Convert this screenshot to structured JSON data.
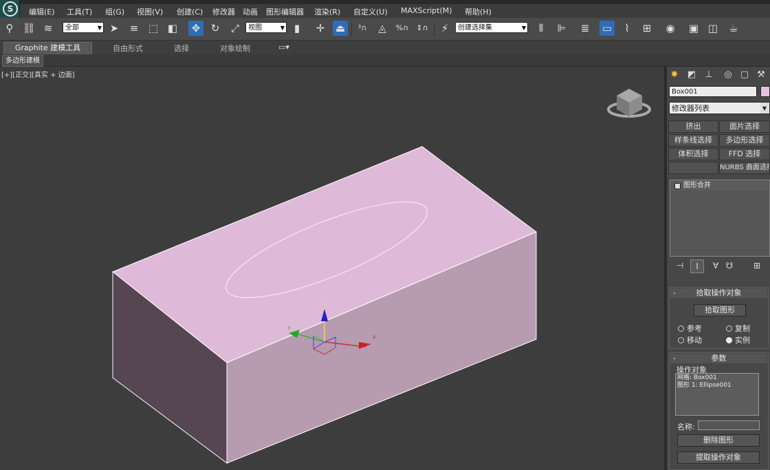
{
  "menu": [
    "编辑(E)",
    "工具(T)",
    "组(G)",
    "视图(V)",
    "创建(C)",
    "修改器",
    "动画",
    "图形编辑器",
    "渲染(R)",
    "自定义(U)",
    "MAXScript(M)",
    "帮助(H)"
  ],
  "toolbar": {
    "filter_select": "全部",
    "coord_select": "视图",
    "selection_set": "创建选择集"
  },
  "ribbon_tabs": [
    "Graphite 建模工具",
    "自由形式",
    "选择",
    "对象绘制"
  ],
  "ribbon_sub": "多边形建模",
  "viewport": {
    "label": "[+][正交][真实 + 边面]",
    "object_color": "#dfbad8"
  },
  "command_panel": {
    "object_name": "Box001",
    "object_color": "#e9bfe0",
    "modifier_list": "修改器列表",
    "mod_buttons": [
      "挤出",
      "面片选择",
      "样条线选择",
      "多边形选择",
      "体积选择",
      "FFD 选择",
      "",
      "NURBS 曲面选择"
    ],
    "stack_item": "图形合并",
    "pick_rollout": {
      "title": "拾取操作对象",
      "button": "拾取图形",
      "radios": [
        "参考",
        "复制",
        "移动",
        "实例"
      ],
      "selected": "实例"
    },
    "params_rollout": {
      "title": "参数",
      "group_label": "操作对象",
      "operands": [
        "网格: Box001",
        "图形 1: Ellipse001"
      ],
      "name_label": "名称:",
      "delete_button": "删除图形",
      "extract_button": "提取操作对象"
    }
  }
}
